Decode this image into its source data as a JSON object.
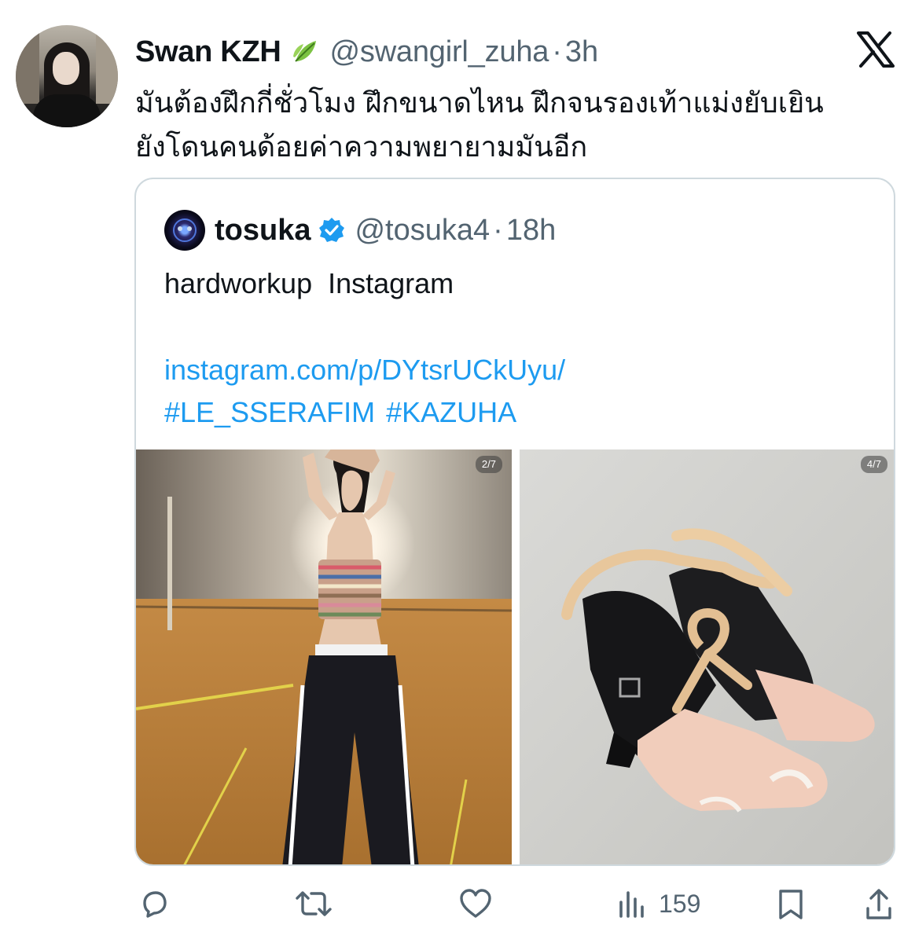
{
  "tweet": {
    "display_name": "Swan KZH",
    "name_emoji": "leaf-icon",
    "handle": "@swangirl_zuha",
    "separator": "·",
    "time": "3h",
    "text_lines": [
      "มันต้องฝึกกี่ชั่วโมง ฝึกขนาดไหน ฝึกจนรองเท้าแม่งยับเยิน",
      "ยังโดนคนด้อยค่าความพยายามมันอีก"
    ]
  },
  "quoted": {
    "display_name": "tosuka",
    "verified": true,
    "handle": "@tosuka4",
    "separator": "·",
    "time": "18h",
    "text": "hardworkup  Instagram",
    "link": "instagram.com/p/DYtsrUCkUyu/",
    "hashtags": [
      "#LE_SSERAFIM",
      "#KAZUHA"
    ],
    "media": [
      {
        "badge": "2/7",
        "description": "dancer-mirror-selfie"
      },
      {
        "badge": "4/7",
        "description": "worn-pointe-style-heels"
      }
    ]
  },
  "actions": {
    "views": "159"
  },
  "colors": {
    "accent": "#1d9bf0",
    "secondary_text": "#536471",
    "border": "#cfd9de",
    "leaf": "#6db33f"
  }
}
